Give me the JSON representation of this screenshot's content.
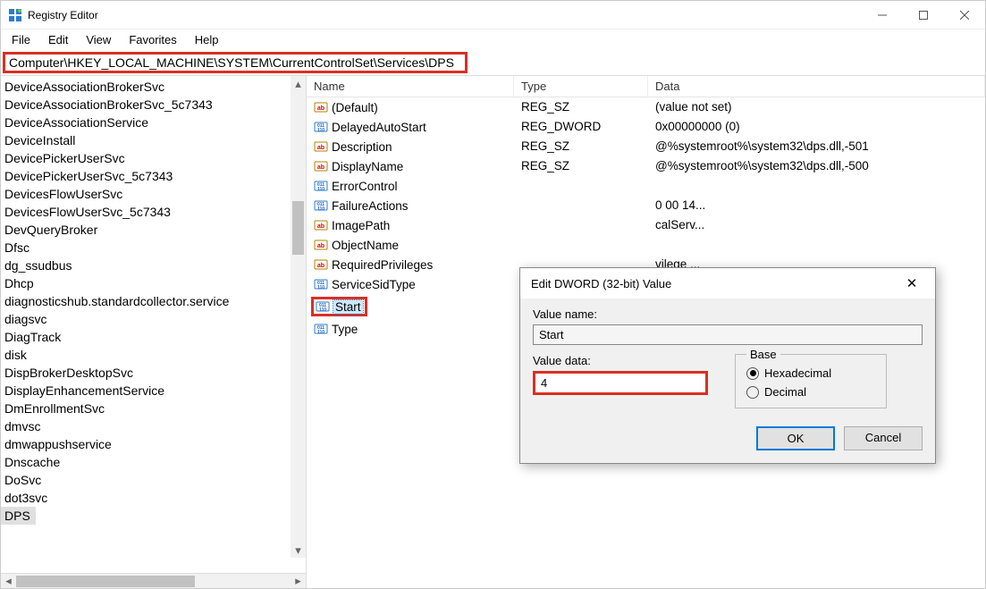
{
  "titlebar": {
    "title": "Registry Editor"
  },
  "menubar": [
    "File",
    "Edit",
    "View",
    "Favorites",
    "Help"
  ],
  "addressbar": "Computer\\HKEY_LOCAL_MACHINE\\SYSTEM\\CurrentControlSet\\Services\\DPS",
  "tree": {
    "items": [
      "DeviceAssociationBrokerSvc",
      "DeviceAssociationBrokerSvc_5c7343",
      "DeviceAssociationService",
      "DeviceInstall",
      "DevicePickerUserSvc",
      "DevicePickerUserSvc_5c7343",
      "DevicesFlowUserSvc",
      "DevicesFlowUserSvc_5c7343",
      "DevQueryBroker",
      "Dfsc",
      "dg_ssudbus",
      "Dhcp",
      "diagnosticshub.standardcollector.service",
      "diagsvc",
      "DiagTrack",
      "disk",
      "DispBrokerDesktopSvc",
      "DisplayEnhancementService",
      "DmEnrollmentSvc",
      "dmvsc",
      "dmwappushservice",
      "Dnscache",
      "DoSvc",
      "dot3svc",
      "DPS"
    ],
    "selected": "DPS"
  },
  "list": {
    "headers": {
      "name": "Name",
      "type": "Type",
      "data": "Data"
    },
    "rows": [
      {
        "icon": "sz",
        "name": "(Default)",
        "type": "REG_SZ",
        "data": "(value not set)"
      },
      {
        "icon": "dw",
        "name": "DelayedAutoStart",
        "type": "REG_DWORD",
        "data": "0x00000000 (0)"
      },
      {
        "icon": "sz",
        "name": "Description",
        "type": "REG_SZ",
        "data": "@%systemroot%\\system32\\dps.dll,-501"
      },
      {
        "icon": "sz",
        "name": "DisplayName",
        "type": "REG_SZ",
        "data": "@%systemroot%\\system32\\dps.dll,-500"
      },
      {
        "icon": "dw",
        "name": "ErrorControl",
        "type": "",
        "data": ""
      },
      {
        "icon": "dw",
        "name": "FailureActions",
        "type": "",
        "data": "0 00 14..."
      },
      {
        "icon": "sz",
        "name": "ImagePath",
        "type": "",
        "data": "calServ..."
      },
      {
        "icon": "sz",
        "name": "ObjectName",
        "type": "",
        "data": ""
      },
      {
        "icon": "sz",
        "name": "RequiredPrivileges",
        "type": "",
        "data": "vilege ..."
      },
      {
        "icon": "dw",
        "name": "ServiceSidType",
        "type": "",
        "data": ""
      },
      {
        "icon": "dw",
        "name": "Start",
        "type": "",
        "data": "",
        "selected": true
      },
      {
        "icon": "dw",
        "name": "Type",
        "type": "",
        "data": ""
      }
    ]
  },
  "dialog": {
    "title": "Edit DWORD (32-bit) Value",
    "value_name_label": "Value name:",
    "value_name": "Start",
    "value_data_label": "Value data:",
    "value_data": "4",
    "base_label": "Base",
    "base_hex": "Hexadecimal",
    "base_dec": "Decimal",
    "ok": "OK",
    "cancel": "Cancel"
  }
}
